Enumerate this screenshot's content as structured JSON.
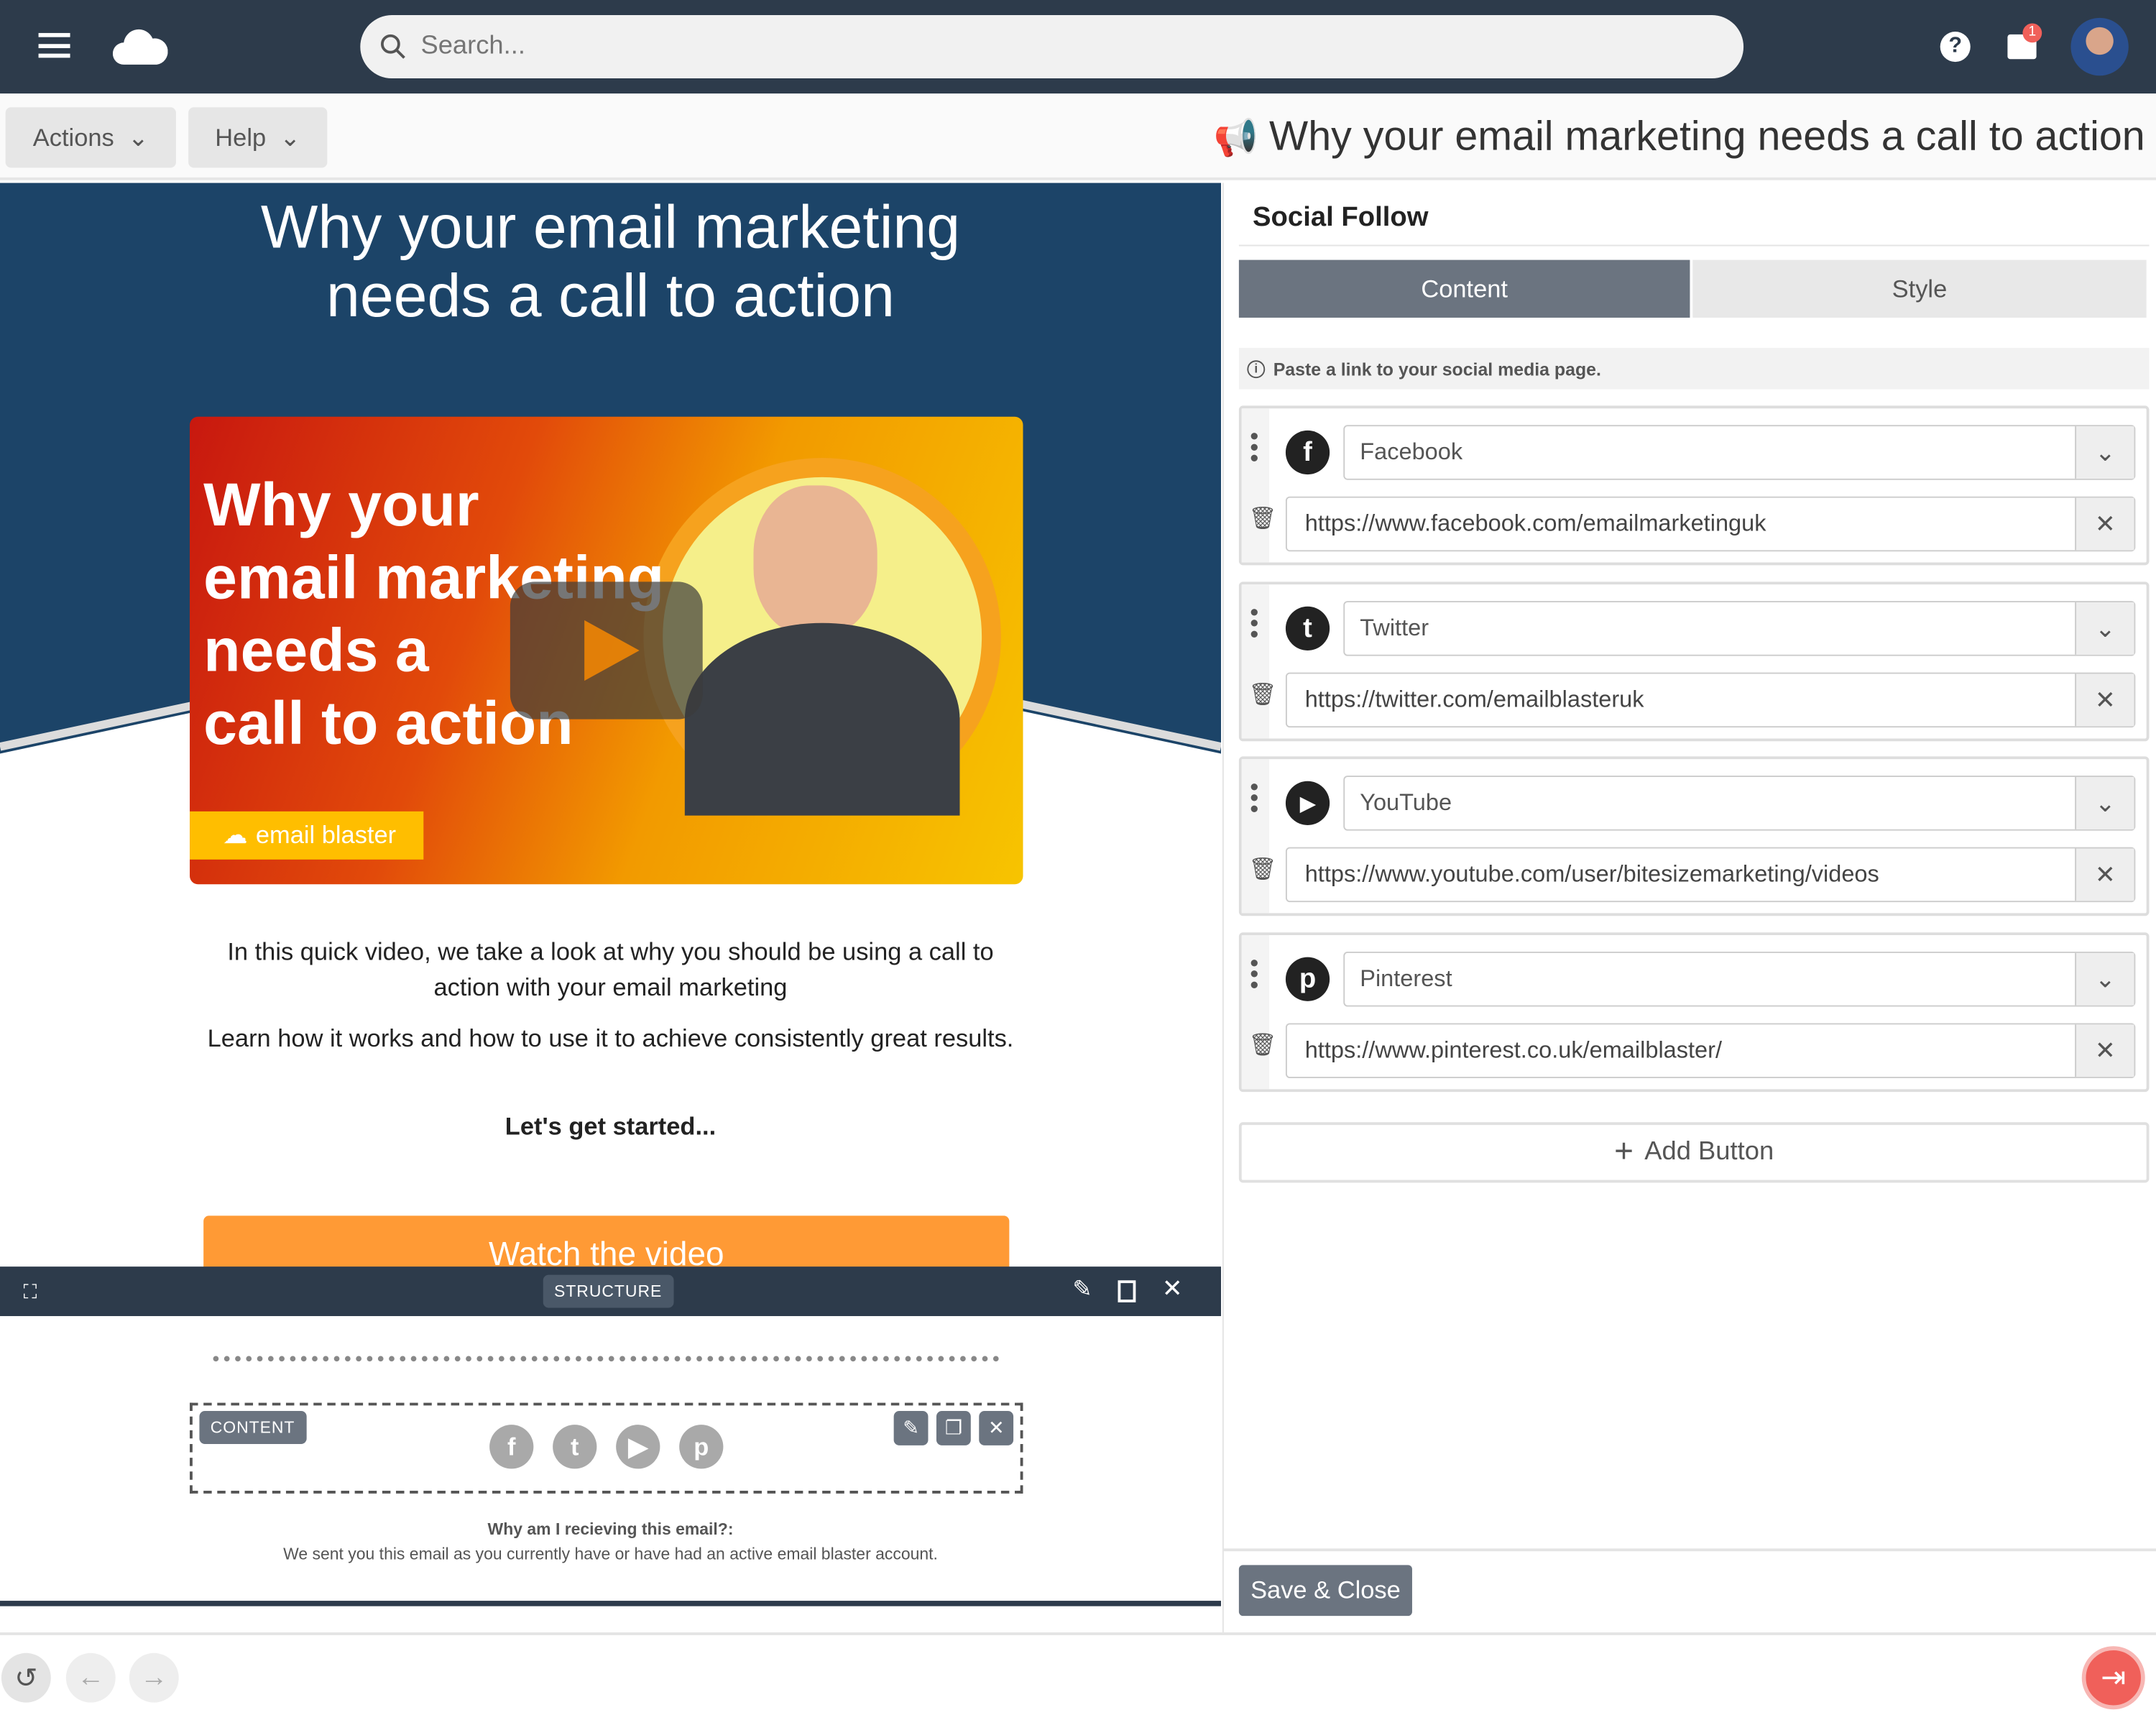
{
  "header": {
    "search_placeholder": "Search...",
    "notification_count": "1"
  },
  "toolbar": {
    "actions_label": "Actions",
    "help_label": "Help",
    "page_title": "Why your email marketing needs a call to action"
  },
  "email": {
    "heading_line1": "Why your email marketing",
    "heading_line2": "needs a call to action",
    "thumbnail": {
      "lines": [
        "Why your",
        "email marketing",
        "needs a",
        "call to action"
      ],
      "brand": "email blaster"
    },
    "para1": "In this quick video, we take a look at why you should be using a call to action with your email marketing",
    "para2": "Learn how it works and how to use it to achieve consistently great results.",
    "para3": "Let's get started...",
    "cta": "Watch the video",
    "structure_label": "STRUCTURE",
    "content_label": "CONTENT",
    "footer_title": "Why am I recieving this email?:",
    "footer_text": "We sent you this email as you currently have or have had an active email blaster account."
  },
  "panel": {
    "title": "Social Follow",
    "tabs": [
      {
        "label": "Content",
        "active": true
      },
      {
        "label": "Style",
        "active": false
      }
    ],
    "info": "Paste a link to your social media page.",
    "items": [
      {
        "network": "Facebook",
        "icon": "facebook-icon",
        "url": "https://www.facebook.com/emailmarketinguk"
      },
      {
        "network": "Twitter",
        "icon": "twitter-icon",
        "url": "https://twitter.com/emailblasteruk"
      },
      {
        "network": "YouTube",
        "icon": "youtube-icon",
        "url": "https://www.youtube.com/user/bitesizemarketing/videos"
      },
      {
        "network": "Pinterest",
        "icon": "pinterest-icon",
        "url": "https://www.pinterest.co.uk/emailblaster/"
      }
    ],
    "add_button": "Add Button",
    "save_close": "Save & Close"
  },
  "colors": {
    "header": "#2d3b4b",
    "hero": "#1c4468",
    "cta": "#ff9a35",
    "tab_active": "#6b7480",
    "exit": "#f0605a"
  }
}
